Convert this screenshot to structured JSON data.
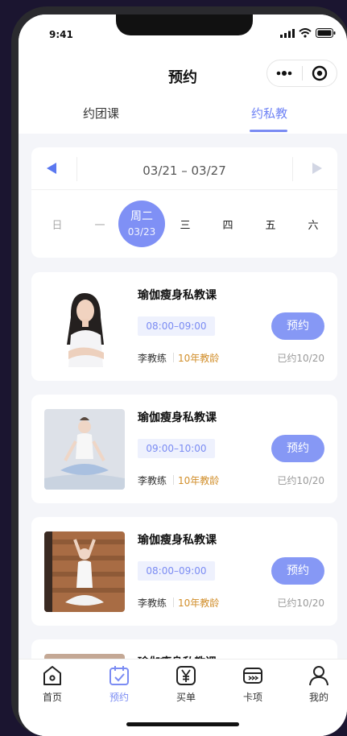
{
  "status": {
    "time": "9:41"
  },
  "header": {
    "title": "预约"
  },
  "tabs": [
    {
      "label": "约团课",
      "active": false
    },
    {
      "label": "约私教",
      "active": true
    }
  ],
  "calendar": {
    "range": "03/21 – 03/27",
    "days": [
      {
        "weekday": "日"
      },
      {
        "weekday": "一"
      },
      {
        "weekday": "周二",
        "date": "03/23",
        "selected": true
      },
      {
        "weekday": "三"
      },
      {
        "weekday": "四"
      },
      {
        "weekday": "五"
      },
      {
        "weekday": "六"
      }
    ]
  },
  "courses": [
    {
      "name": "瑜伽瘦身私教课",
      "time": "08:00–09:00",
      "coach": "李教练",
      "experience": "10年教龄",
      "booked": "已约10/20",
      "button": "预约"
    },
    {
      "name": "瑜伽瘦身私教课",
      "time": "09:00–10:00",
      "coach": "李教练",
      "experience": "10年教龄",
      "booked": "已约10/20",
      "button": "预约"
    },
    {
      "name": "瑜伽瘦身私教课",
      "time": "08:00–09:00",
      "coach": "李教练",
      "experience": "10年教龄",
      "booked": "已约10/20",
      "button": "预约"
    },
    {
      "name": "瑜伽瘦身私教课"
    }
  ],
  "tabbar": [
    {
      "label": "首页",
      "icon": "home-icon"
    },
    {
      "label": "预约",
      "icon": "calendar-check-icon",
      "active": true
    },
    {
      "label": "买单",
      "icon": "yen-icon"
    },
    {
      "label": "卡项",
      "icon": "card-icon"
    },
    {
      "label": "我的",
      "icon": "user-icon"
    }
  ],
  "colors": {
    "accent": "#7b8cf3",
    "button": "#8698f5",
    "experience": "#d18e2a"
  }
}
